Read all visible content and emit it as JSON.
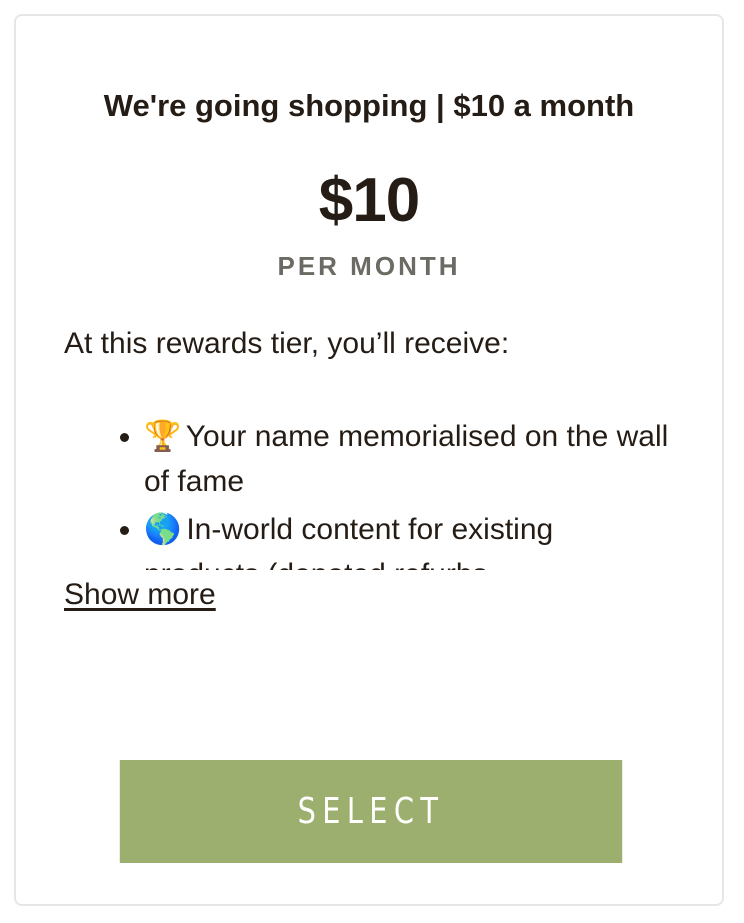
{
  "tier": {
    "title": "We're going shopping | $10 a month",
    "price": "$10",
    "period": "PER MONTH",
    "intro": "At this rewards tier, you’ll receive:",
    "rewards": [
      {
        "icon": "trophy-icon",
        "emoji": "🏆",
        "text": "Your name memorialised on the wall of fame"
      },
      {
        "icon": "globe-icon",
        "emoji": "🌎",
        "text": "In-world content for existing products (donated refurbs..."
      }
    ],
    "show_more_label": "Show more",
    "select_label": "SELECT"
  },
  "colors": {
    "text": "#241c15",
    "muted": "#6b6a63",
    "button": "#9caf6e",
    "border": "#e6e6e6"
  }
}
